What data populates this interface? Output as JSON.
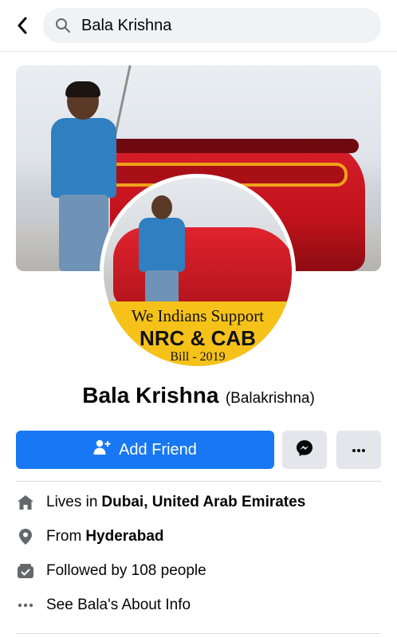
{
  "search": {
    "query": "Bala Krishna"
  },
  "avatar_banner": {
    "line1": "We Indians Support",
    "line2": "NRC & CAB",
    "line3": "Bill - 2019"
  },
  "profile": {
    "name": "Bala Krishna",
    "alternate_name": "(Balakrishna)"
  },
  "actions": {
    "add_friend_label": "Add Friend"
  },
  "info": {
    "lives_prefix": "Lives in",
    "lives_value": "Dubai, United Arab Emirates",
    "from_prefix": "From",
    "from_value": "Hyderabad",
    "followed": "Followed by 108 people",
    "about": "See Bala's About Info"
  },
  "colors": {
    "primary": "#1877f2",
    "icon_gray": "#65676b",
    "button_gray": "#e4e6eb"
  }
}
